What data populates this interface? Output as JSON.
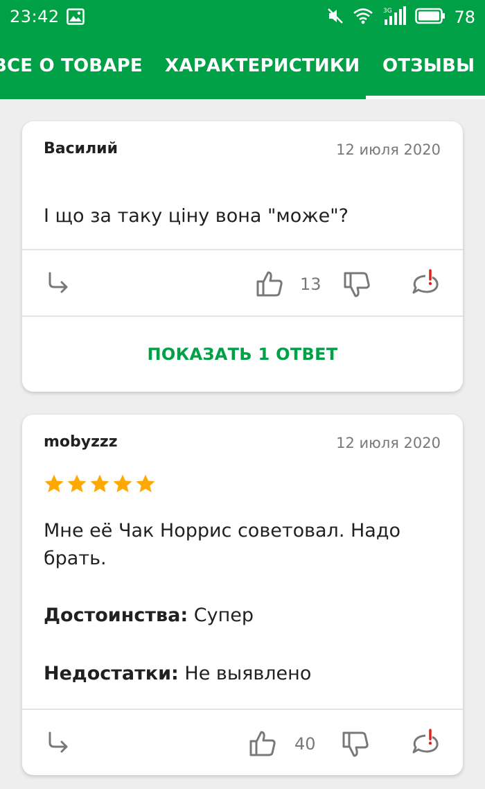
{
  "status_bar": {
    "time": "23:42",
    "battery": "78",
    "network": "3G",
    "icons": [
      "image-icon",
      "mute-icon",
      "wifi-icon",
      "signal-icon",
      "battery-icon"
    ]
  },
  "tabs": [
    {
      "label": "ВСЕ О ТОВАРЕ",
      "active": false
    },
    {
      "label": "ХАРАКТЕРИСТИКИ",
      "active": false
    },
    {
      "label": "ОТЗЫВЫ",
      "active": true
    }
  ],
  "reviews": [
    {
      "author": "Василий",
      "date": "12 июля 2020",
      "text": "І що за таку ціну вона \"може\"?",
      "likes": "13",
      "show_answers_label": "ПОКАЗАТЬ 1 ОТВЕТ"
    },
    {
      "author": "mobyzzz",
      "date": "12 июля 2020",
      "rating": 5,
      "text": "Мне её Чак Норрис советовал. Надо брать.",
      "pros_label": "Достоинства:",
      "pros_value": "Супер",
      "cons_label": "Недостатки:",
      "cons_value": "Не выявлено",
      "likes": "40"
    }
  ],
  "colors": {
    "brand": "#00a046",
    "star": "#ffa900",
    "report": "#e0201a",
    "icon": "#797878"
  }
}
